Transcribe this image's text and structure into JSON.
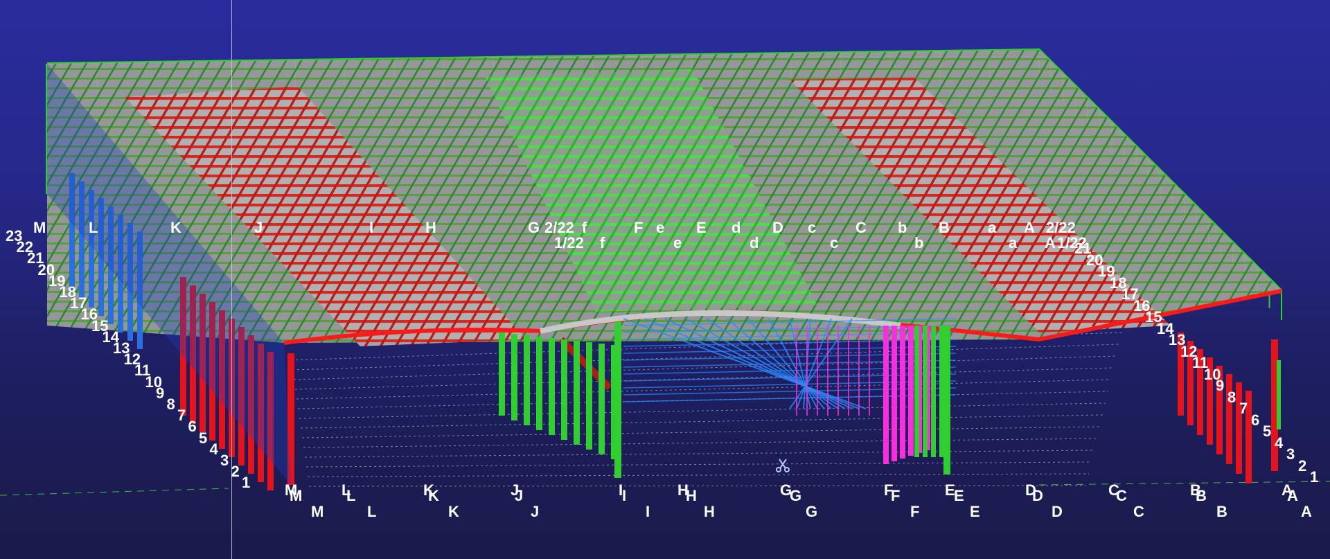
{
  "viewer": {
    "background_top": "#2a2c9e",
    "background_bottom": "#1a1b4a"
  },
  "colors": {
    "frame_green": "#2fcf2f",
    "column_red": "#e8121a",
    "column_blue": "#2a6fe0",
    "column_magenta": "#ff2be0",
    "purlin_grey": "#a8a8a8",
    "rafter_red": "#ff1a1a"
  },
  "labels": {
    "top_row_upper": [
      "M",
      "L",
      "K",
      "J",
      "I",
      "H",
      "G",
      "2/22",
      "f",
      "F",
      "e",
      "E",
      "d",
      "D",
      "c",
      "C",
      "b",
      "B",
      "a",
      "A",
      "2/22"
    ],
    "top_row_lower": [
      "1/22",
      "f",
      "e",
      "d",
      "c",
      "b",
      "a",
      "A",
      "1/22"
    ],
    "left_axis": [
      "23",
      "22",
      "21",
      "20",
      "19",
      "18",
      "17",
      "16",
      "15",
      "14",
      "13",
      "12",
      "11",
      "10",
      "9",
      "8",
      "7",
      "6",
      "5",
      "4",
      "3",
      "2",
      "1"
    ],
    "right_axis": [
      "21",
      "20",
      "19",
      "18",
      "17",
      "16",
      "15",
      "14",
      "13",
      "12",
      "11",
      "10",
      "9",
      "8",
      "7",
      "6",
      "5",
      "4",
      "3",
      "2",
      "1"
    ],
    "bottom_row_1": [
      "M",
      "L",
      "K",
      "J",
      "I",
      "H",
      "G",
      "F",
      "E",
      "D",
      "C",
      "B",
      "A"
    ],
    "bottom_row_2": [
      "M",
      "L",
      "K",
      "J",
      "I",
      "H",
      "G",
      "F",
      "E",
      "D",
      "C",
      "B",
      "A"
    ],
    "bottom_row_3": [
      "M",
      "L",
      "K",
      "J",
      "I",
      "H",
      "G",
      "F",
      "E",
      "D",
      "C",
      "B",
      "A"
    ]
  },
  "icons": {
    "cursor_tool": "scissors-icon"
  }
}
